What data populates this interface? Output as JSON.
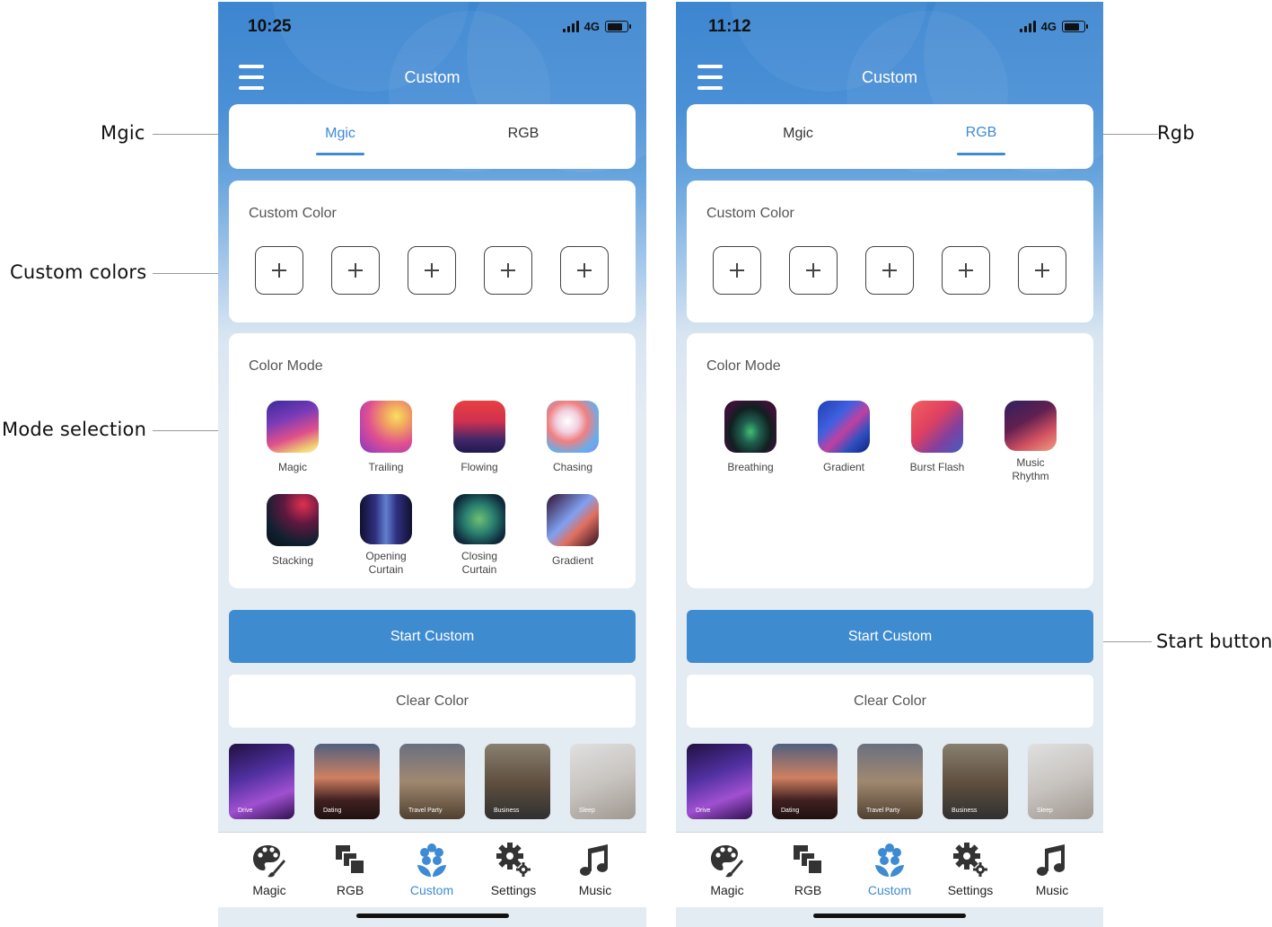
{
  "callouts": {
    "mgic": "Mgic",
    "custom_colors": "Custom colors",
    "mode_selection": "Mode selection",
    "rgb": "Rgb",
    "start_button": "Start button"
  },
  "colors": {
    "accent": "#3e8bd3",
    "header": "#4a90d6",
    "background": "#e3ebf3"
  },
  "phones": [
    {
      "time": "10:25",
      "network": "4G",
      "title": "Custom",
      "tabs": {
        "magic": "Mgic",
        "rgb": "RGB",
        "active": "magic"
      },
      "custom_color_title": "Custom Color",
      "color_mode_title": "Color Mode",
      "modes": [
        {
          "label": "Magic"
        },
        {
          "label": "Trailing"
        },
        {
          "label": "Flowing"
        },
        {
          "label": "Chasing"
        },
        {
          "label": "Stacking"
        },
        {
          "label": "Opening Curtain"
        },
        {
          "label": "Closing Curtain"
        },
        {
          "label": "Gradient"
        }
      ],
      "start_label": "Start Custom",
      "clear_label": "Clear Color",
      "scenes": [
        "Drive",
        "Dating",
        "Travel Party",
        "Business",
        "Sleep"
      ],
      "tabbar": {
        "magic": "Magic",
        "rgb": "RGB",
        "custom": "Custom",
        "settings": "Settings",
        "music": "Music"
      }
    },
    {
      "time": "11:12",
      "network": "4G",
      "title": "Custom",
      "tabs": {
        "magic": "Mgic",
        "rgb": "RGB",
        "active": "rgb"
      },
      "custom_color_title": "Custom Color",
      "color_mode_title": "Color Mode",
      "modes": [
        {
          "label": "Breathing"
        },
        {
          "label": "Gradient"
        },
        {
          "label": "Burst Flash"
        },
        {
          "label": "Music Rhythm"
        }
      ],
      "start_label": "Start Custom",
      "clear_label": "Clear Color",
      "scenes": [
        "Drive",
        "Dating",
        "Travel Party",
        "Business",
        "Sleep"
      ],
      "tabbar": {
        "magic": "Magic",
        "rgb": "RGB",
        "custom": "Custom",
        "settings": "Settings",
        "music": "Music"
      }
    }
  ]
}
